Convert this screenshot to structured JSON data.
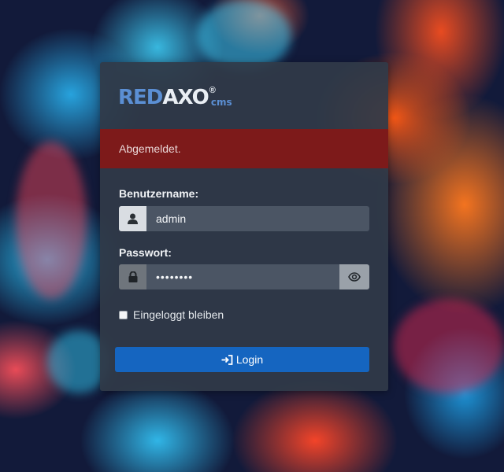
{
  "logo": {
    "part1": "RED",
    "part2": "AXO",
    "registered": "®",
    "suffix": "cms"
  },
  "alert": {
    "message": "Abgemeldet."
  },
  "username": {
    "label": "Benutzername:",
    "value": "admin",
    "icon": "user-icon"
  },
  "password": {
    "label": "Passwort:",
    "value": "••••••••",
    "icon": "lock-icon",
    "toggle_icon": "eye-icon"
  },
  "remember": {
    "label": "Eingeloggt bleiben",
    "checked": false
  },
  "login_button": {
    "label": "Login",
    "icon": "sign-in-icon"
  },
  "colors": {
    "alert_bg": "#7d1a1a",
    "button_bg": "#1565c0",
    "logo_accent": "#5b8fd4"
  }
}
